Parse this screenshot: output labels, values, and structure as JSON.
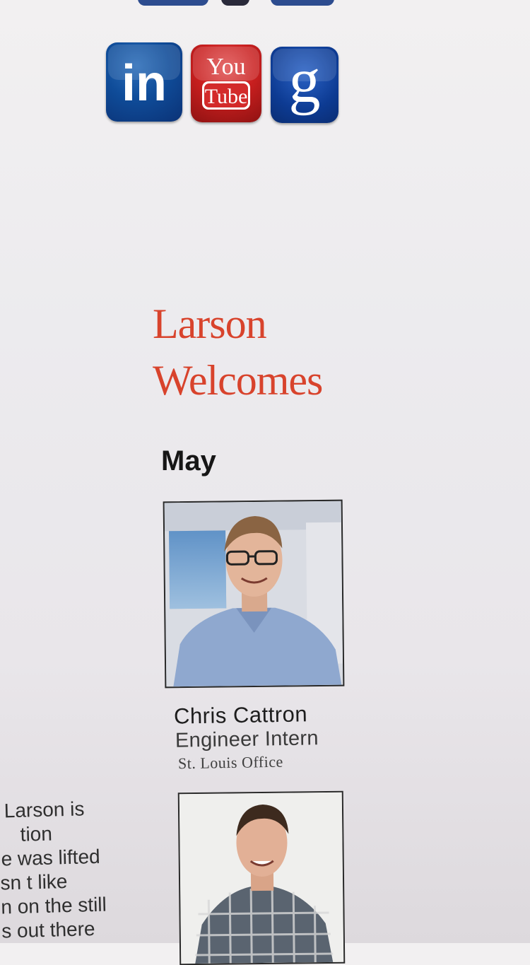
{
  "social": {
    "linkedin": {
      "label": "in",
      "icon": "linkedin-icon",
      "color": "#0f4c99"
    },
    "youtube": {
      "label_top": "You",
      "label_bottom": "Tube",
      "icon": "youtube-icon",
      "color": "#c91f1f"
    },
    "google": {
      "label": "g",
      "icon": "google-icon",
      "color": "#0d3b93"
    }
  },
  "welcome": {
    "title_line1": "Larson",
    "title_line2": "Welcomes",
    "title_color": "#d8432c",
    "month": "May"
  },
  "people": [
    {
      "name": "Chris Cattron",
      "role": "Engineer Intern",
      "office": "St. Louis Office"
    }
  ],
  "article_fragment": {
    "lines": [
      "Larson is",
      "tion",
      "e was lifted",
      "sn t like",
      "n on the still",
      "s out there"
    ]
  }
}
